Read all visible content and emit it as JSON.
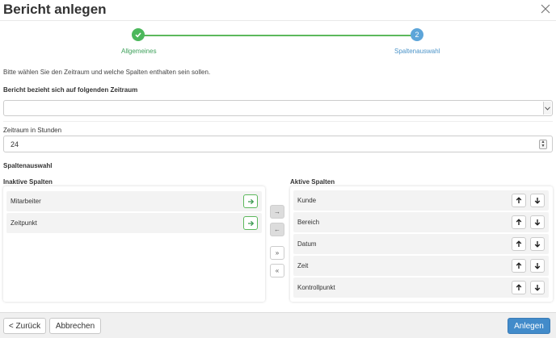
{
  "dialog": {
    "title": "Bericht anlegen",
    "close_icon": "close-icon"
  },
  "stepper": {
    "steps": [
      {
        "label": "Allgemeines",
        "state": "done",
        "icon": "check-icon"
      },
      {
        "label": "Spaltenauswahl",
        "state": "current",
        "number": "2"
      }
    ],
    "colors": {
      "done": "#4cb85c",
      "current": "#5da5d9"
    }
  },
  "intro_text": "Bitte wählen Sie den Zeitraum und welche Spalten enthalten sein sollen.",
  "period_select": {
    "label": "Bericht bezieht sich auf folgenden Zeitraum",
    "value": ""
  },
  "hours_field": {
    "label": "Zeitraum in Stunden",
    "value": "24"
  },
  "columns_section": {
    "title": "Spaltenauswahl",
    "inactive": {
      "title": "Inaktive Spalten",
      "items": [
        "Mitarbeiter",
        "Zeitpunkt"
      ]
    },
    "active": {
      "title": "Aktive Spalten",
      "items": [
        "Kunde",
        "Bereich",
        "Datum",
        "Zeit",
        "Kontrollpunkt"
      ]
    },
    "transfer_buttons": {
      "move_right": "→",
      "move_left": "←",
      "move_all_right": "»",
      "move_all_left": "«"
    }
  },
  "footer": {
    "back_label": "< Zurück",
    "cancel_label": "Abbrechen",
    "create_label": "Anlegen"
  }
}
